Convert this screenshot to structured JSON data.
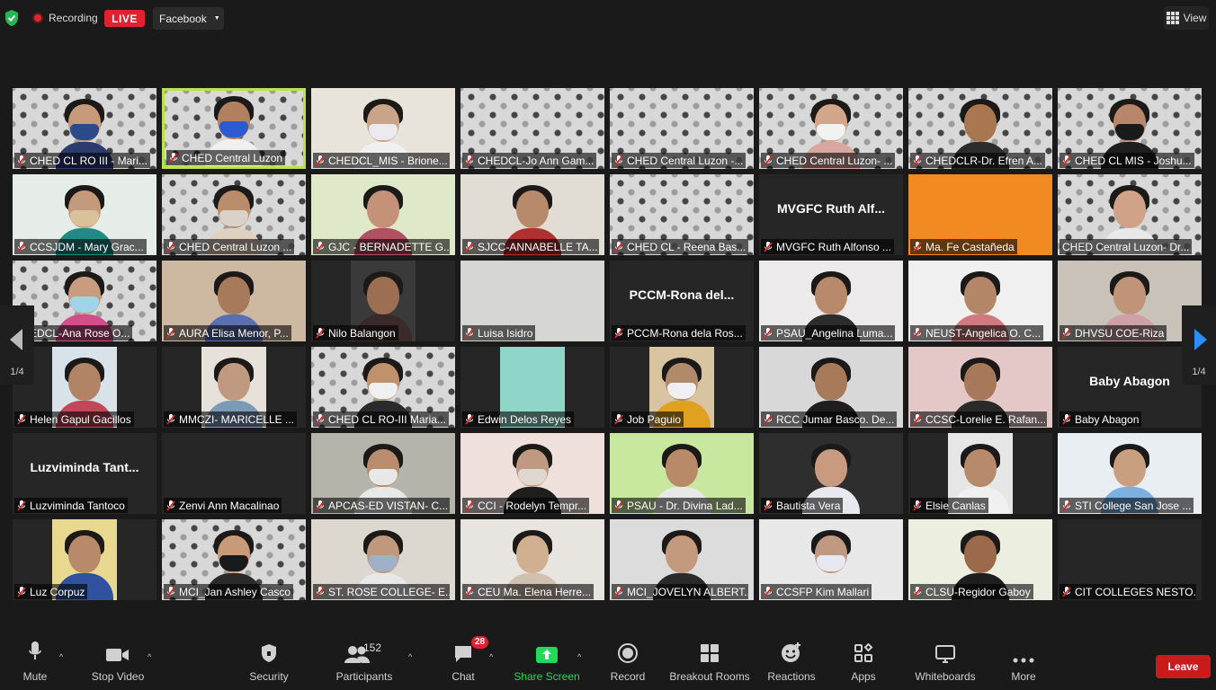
{
  "top": {
    "recording_label": "Recording",
    "live_label": "LIVE",
    "stream_target": "Facebook",
    "view_label": "View"
  },
  "gallery": {
    "page_left": "1/4",
    "page_right": "1/4",
    "tiles": [
      {
        "label": "CHED CL RO III - Mari...",
        "kind": "video",
        "bg": "pat",
        "skin": "#c89a7c",
        "top": "#2c3b6e",
        "mask": "#2a4a8a"
      },
      {
        "label": "CHED Central Luzon",
        "kind": "video",
        "bg": "pat",
        "skin": "#b08060",
        "top": "#f0f0f0",
        "mask": "#2a5bd0",
        "active": true
      },
      {
        "label": "CHEDCL_MIS - Brione...",
        "kind": "video",
        "bg": "#e8e4dc",
        "skin": "#caa488",
        "top": "#f0f0f0",
        "mask": "#e9e9ee"
      },
      {
        "label": "CHEDCL-Jo Ann Gam...",
        "kind": "video",
        "bg": "pat",
        "skin": "",
        "top": "",
        "mask": ""
      },
      {
        "label": "CHED Central Luzon -...",
        "kind": "video",
        "bg": "pat",
        "skin": "",
        "top": "",
        "mask": ""
      },
      {
        "label": "CHED Central Luzon- ...",
        "kind": "video",
        "bg": "pat",
        "skin": "#d2a68a",
        "top": "#d8a8a0",
        "mask": "#f2f2f2"
      },
      {
        "label": "CHEDCLR-Dr. Efren A...",
        "kind": "video",
        "bg": "pat",
        "skin": "#a9774f",
        "top": "#2c2c2c",
        "mask": ""
      },
      {
        "label": "CHED CL MIS - Joshu...",
        "kind": "video",
        "bg": "pat",
        "skin": "#b8866a",
        "top": "#1e1e1e",
        "mask": "#1a1a1a"
      },
      {
        "label": "CCSJDM - Mary Grac...",
        "kind": "video",
        "bg": "#e6ece8",
        "skin": "#c49a7c",
        "top": "#1f8a86",
        "mask": "#d9c29a"
      },
      {
        "label": "CHED Central Luzon ...",
        "kind": "video",
        "bg": "pat",
        "skin": "#b98d6c",
        "top": "#e0d0c0",
        "mask": "#d9d2c8"
      },
      {
        "label": "GJC - BERNADETTE G...",
        "kind": "video",
        "bg": "#dfe8c8",
        "skin": "#c49278",
        "top": "#b05060",
        "mask": ""
      },
      {
        "label": "SJCC-ANNABELLE TA...",
        "kind": "video",
        "bg": "#e2ddd4",
        "skin": "#b78a6c",
        "top": "#b03030",
        "mask": ""
      },
      {
        "label": "CHED CL - Reena Bas...",
        "kind": "video",
        "bg": "pat",
        "skin": "",
        "top": "",
        "mask": ""
      },
      {
        "label": "MVGFC Ruth Alfonso ...",
        "kind": "name",
        "name": "MVGFC Ruth Alf..."
      },
      {
        "label": "Ma. Fe Castañeda",
        "kind": "solid",
        "bg": "#f28a22"
      },
      {
        "label": "CHED Central Luzon- Dr...",
        "kind": "video",
        "bg": "pat",
        "skin": "#d0a288",
        "top": "#e8e8e8",
        "mask": "",
        "nomic": true
      },
      {
        "label": "EDCL-Ana Rose O...",
        "kind": "video",
        "bg": "pat",
        "skin": "#c99c80",
        "top": "#d04e8a",
        "mask": "#9fd4ea"
      },
      {
        "label": "AURA Elisa Menor, P...",
        "kind": "video",
        "bg": "#cdb8a2",
        "skin": "#a87a5c",
        "top": "#5a6fb0",
        "mask": ""
      },
      {
        "label": "Nilo Balangon",
        "kind": "video",
        "bg": "#3a3a3a",
        "skin": "#9c6f52",
        "top": "#3a2a2a",
        "mask": "",
        "narrow": true
      },
      {
        "label": "Luisa Isidro",
        "kind": "video",
        "bg": "#d6d6d4",
        "skin": "",
        "top": "",
        "mask": ""
      },
      {
        "label": "PCCM-Rona dela Ros...",
        "kind": "name",
        "name": "PCCM-Rona del..."
      },
      {
        "label": "PSAU_Angelina Luma...",
        "kind": "video",
        "bg": "#eceaea",
        "skin": "#b88a6c",
        "top": "#2c2c2c",
        "mask": ""
      },
      {
        "label": "NEUST-Angelica O. C...",
        "kind": "video",
        "bg": "#f0f0f0",
        "skin": "#b48668",
        "top": "#d07a80",
        "mask": ""
      },
      {
        "label": "DHVSU COE-Riza",
        "kind": "video",
        "bg": "#c8c2b8",
        "skin": "#c09478",
        "top": "#d0a0a8",
        "mask": ""
      },
      {
        "label": "Helen Gapul Gacillos",
        "kind": "video",
        "bg": "#d8e2ea",
        "skin": "#b08464",
        "top": "#c04858",
        "mask": "",
        "narrow": true
      },
      {
        "label": "MMCZI- MARICELLE ...",
        "kind": "video",
        "bg": "#e6e2da",
        "skin": "#c09a80",
        "top": "#7a9ab8",
        "mask": "",
        "narrow": true
      },
      {
        "label": "CHED CL RO-III Maria...",
        "kind": "video",
        "bg": "pat",
        "skin": "#c0926c",
        "top": "#2a2a2a",
        "mask": "#f0f0f0"
      },
      {
        "label": "Edwin Delos Reyes",
        "kind": "video",
        "bg": "#8fd6c8",
        "skin": "",
        "top": "",
        "mask": "",
        "narrow": true
      },
      {
        "label": "Job Paguio",
        "kind": "video",
        "bg": "#d8c4a0",
        "skin": "#b08a6a",
        "top": "#e0a020",
        "mask": "#f0f0f0",
        "narrow": true
      },
      {
        "label": "RCC Jumar Basco. De...",
        "kind": "video",
        "bg": "#d8d8d8",
        "skin": "#a87a5a",
        "top": "#1e1e1e",
        "mask": ""
      },
      {
        "label": "CCSC-Lorelie E. Rafan...",
        "kind": "video",
        "bg": "#e4c8c8",
        "skin": "#a8785a",
        "top": "#2a2a2a",
        "mask": ""
      },
      {
        "label": "Baby Abagon",
        "kind": "name",
        "name": "Baby Abagon"
      },
      {
        "label": "Luzviminda Tantoco",
        "kind": "name",
        "name": "Luzviminda Tant..."
      },
      {
        "label": "Zenvi Ann Macalinao",
        "kind": "blank"
      },
      {
        "label": "APCAS-ED VISTAN- C...",
        "kind": "video",
        "bg": "#b4b4aa",
        "skin": "#b88c6c",
        "top": "#e8e8e8",
        "mask": "#e8e8e8"
      },
      {
        "label": "CCI - Rodelyn Tempr...",
        "kind": "video",
        "bg": "#f0e0dc",
        "skin": "#c09a80",
        "top": "#1e1e1e",
        "mask": "#e0d8d0"
      },
      {
        "label": "PSAU - Dr. Divina Lad...",
        "kind": "video",
        "bg": "#c8e8a0",
        "skin": "#b88a68",
        "top": "#e8e8e8",
        "mask": ""
      },
      {
        "label": "Bautista Vera",
        "kind": "video",
        "bg": "#2e2e2e",
        "skin": "#c89a80",
        "top": "#e8e8f0",
        "mask": ""
      },
      {
        "label": "Elsie Canlas",
        "kind": "video",
        "bg": "#e6e6e6",
        "skin": "#b88a6c",
        "top": "#f0f0f0",
        "mask": "",
        "narrow": true
      },
      {
        "label": "STI College San Jose ...",
        "kind": "video",
        "bg": "#e8eef2",
        "skin": "#c8a080",
        "top": "#7bb0e0",
        "mask": ""
      },
      {
        "label": "Luz Corpuz",
        "kind": "video",
        "bg": "#e8d890",
        "skin": "#b88a6a",
        "top": "#3050a0",
        "mask": "",
        "narrow": true
      },
      {
        "label": "MCI_Jan Ashley Casco",
        "kind": "video",
        "bg": "pat",
        "skin": "#c89a7a",
        "top": "#2a2a2a",
        "mask": "#1a1a1a"
      },
      {
        "label": "ST. ROSE COLLEGE- E...",
        "kind": "video",
        "bg": "#dcd8d0",
        "skin": "#c0987c",
        "top": "#e8e8e8",
        "mask": "#9fb0c8"
      },
      {
        "label": "CEU Ma. Elena Herre...",
        "kind": "video",
        "bg": "#e8e4e0",
        "skin": "#d0b090",
        "top": "#d0c0b0",
        "mask": ""
      },
      {
        "label": "MCI_JOVELYN ALBERT...",
        "kind": "video",
        "bg": "#dcdcdc",
        "skin": "#c49a7e",
        "top": "#2a2a2a",
        "mask": ""
      },
      {
        "label": "CCSFP Kim Mallari",
        "kind": "video",
        "bg": "#e8e8e8",
        "skin": "#c09a80",
        "top": "#e8e8e8",
        "mask": "#e8e8f0"
      },
      {
        "label": "CLSU-Regidor Gaboy",
        "kind": "video",
        "bg": "#ecefe0",
        "skin": "#9a6a4a",
        "top": "#1e1e1e",
        "mask": ""
      },
      {
        "label": "CIT COLLEGES NESTO...",
        "kind": "blank"
      }
    ]
  },
  "toolbar": {
    "mute": "Mute",
    "stop_video": "Stop Video",
    "security": "Security",
    "participants": "Participants",
    "participants_count": "152",
    "chat": "Chat",
    "chat_badge": "28",
    "share_screen": "Share Screen",
    "record": "Record",
    "breakout_rooms": "Breakout Rooms",
    "reactions": "Reactions",
    "apps": "Apps",
    "whiteboards": "Whiteboards",
    "more": "More",
    "leave": "Leave"
  },
  "colors": {
    "active_speaker": "#b9e34b",
    "share_green": "#23d959",
    "live_red": "#e0212e",
    "pager_blue": "#2d8cff"
  }
}
